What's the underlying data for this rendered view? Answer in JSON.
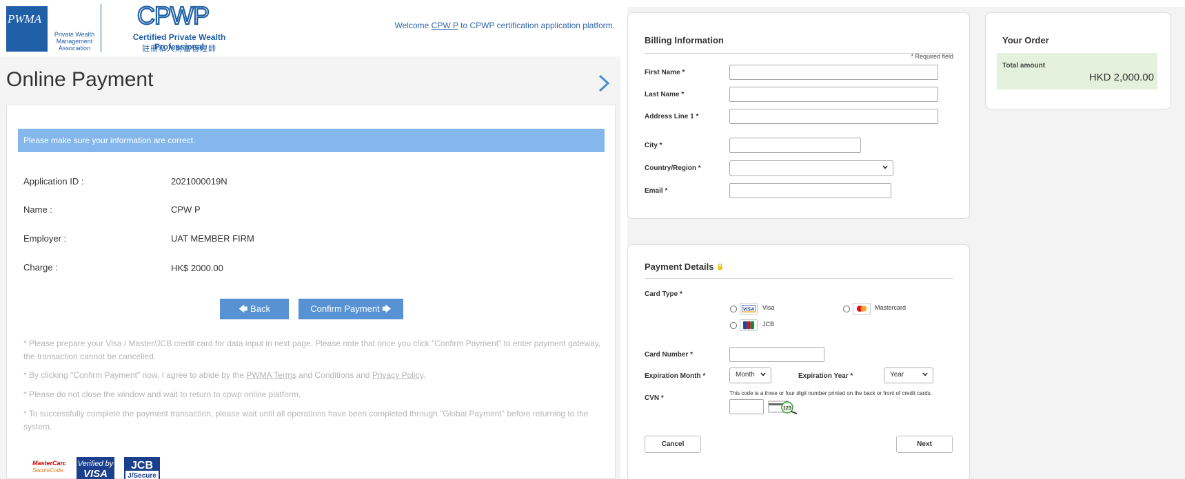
{
  "header": {
    "pwma_logo_text": "PWMA",
    "pwma_name": "Private Wealth Management Association",
    "cpwp_logo_text": "CPWP",
    "cpwp_title": "Certified Private Wealth Professional",
    "cpwp_chinese": "註冊私人財富管理師",
    "welcome_prefix": "Welcome ",
    "welcome_user": "CPW P",
    "welcome_suffix": " to CPWP certification application platform."
  },
  "page": {
    "title": "Online Payment",
    "notice": "Please make sure your information are correct."
  },
  "info": [
    {
      "label": "Application ID :",
      "value": "2021000019N"
    },
    {
      "label": "Name :",
      "value": "CPW P"
    },
    {
      "label": "Employer :",
      "value": "UAT MEMBER FIRM"
    },
    {
      "label": "Charge :",
      "value": "HK$ 2000.00"
    }
  ],
  "buttons": {
    "back": "🡄 Back",
    "confirm": "Confirm Payment 🡆"
  },
  "notes": {
    "n1": "* Please prepare your Visa / Master/JCB credit card for data input in next page. Please note that once you click \"Confirm Payment\" to enter payment gateway, the transaction cannot be cancelled.",
    "n2_prefix": "* By clicking \"Confirm Payment\" now, I agree to abide by the ",
    "n2_link1": "PWMA Terms",
    "n2_mid": " and Conditions and ",
    "n2_link2": "Privacy Policy",
    "n2_suffix": ".",
    "n3": "* Please do not close the window and wait to return to cpwp online platform.",
    "n4": "* To successfully complete the payment transaction, please wait until all operations have been completed through \"Global Payment\" before returning to the system."
  },
  "security_logos": {
    "mastercard_line1": "MasterCard.",
    "mastercard_line2": "SecureCode.",
    "visa_line1": "Verified by",
    "visa_line2": "VISA",
    "jcb_line1": "JCB",
    "jcb_line2": "J/Secure"
  },
  "billing": {
    "title": "Billing Information",
    "required_note": "* Required field",
    "fields": {
      "first_name": "First Name *",
      "last_name": "Last Name *",
      "address1": "Address Line 1 *",
      "city": "City *",
      "country": "Country/Region *",
      "email": "Email *"
    }
  },
  "payment": {
    "title": "Payment Details",
    "card_type_label": "Card Type *",
    "card_types": [
      "Visa",
      "Mastercard",
      "JCB"
    ],
    "card_logo_visa": "VISA",
    "card_number_label": "Card Number *",
    "exp_month_label": "Expiration Month *",
    "exp_month_value": "Month",
    "exp_year_label": "Expiration Year *",
    "exp_year_value": "Year",
    "cvn_label": "CVN *",
    "cvn_note": "This code is a three or four digit number printed on the back or front of credit cards.",
    "cvn_sample": "123",
    "cancel": "Cancel",
    "next": "Next"
  },
  "order": {
    "title": "Your Order",
    "total_label": "Total amount",
    "total_value": "HKD 2,000.00"
  },
  "colors": {
    "brand_blue": "#1f5fa8",
    "notice_bg": "#84b8ec",
    "button_blue": "#5692d4",
    "total_bg": "#e4f2dd"
  }
}
